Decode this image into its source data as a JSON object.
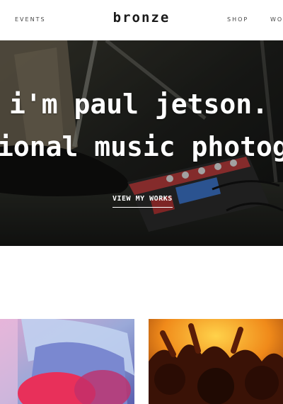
{
  "nav": {
    "left_link": "EVENTS",
    "brand": "bronze",
    "right_links": [
      "SHOP",
      "WO"
    ]
  },
  "hero": {
    "line1": "i'm paul jetson.",
    "line2": "ional music photog",
    "cta_label": "VIEW MY WORKS"
  },
  "gallery": {
    "items": [
      "portrait-photo",
      "concert-crowd-photo"
    ]
  },
  "colors": {
    "hero_overlay": "#1e1f1c",
    "gallery_left_accent": "#e8305a",
    "gallery_right_accent": "#f08a1a"
  }
}
